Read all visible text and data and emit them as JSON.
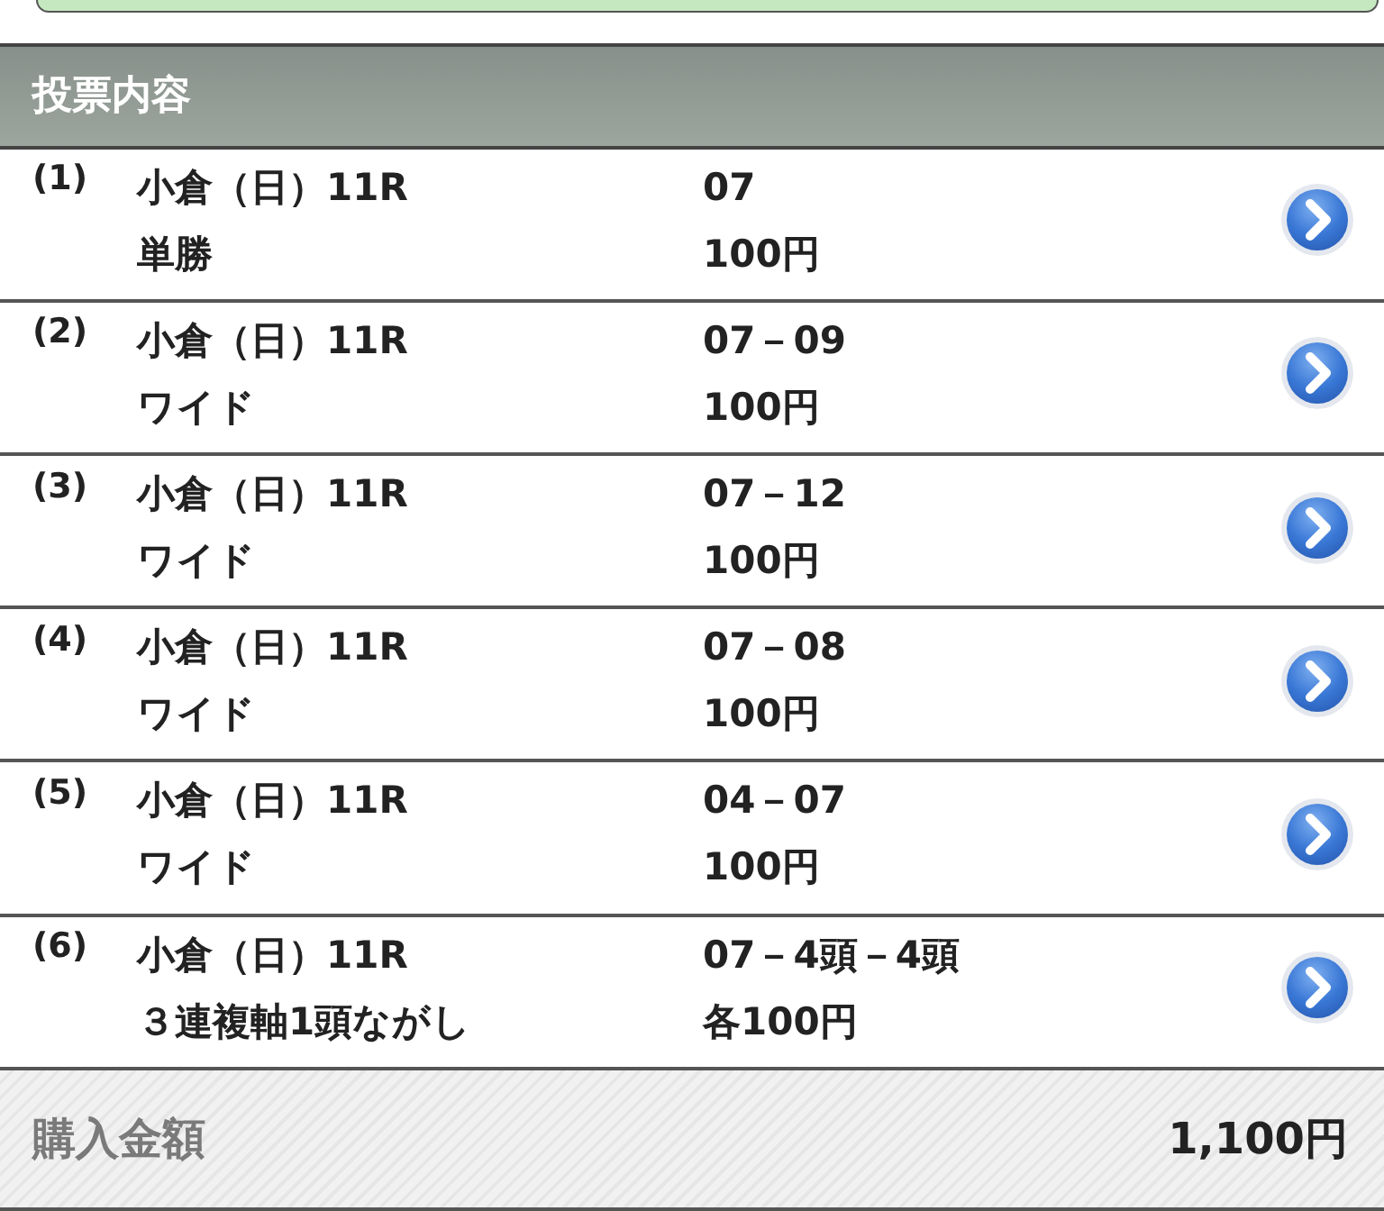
{
  "section_title": "投票内容",
  "bets": [
    {
      "number": "(1)",
      "race": "小倉（日）11R",
      "bet_type": "単勝",
      "selection": "07",
      "amount": "100円"
    },
    {
      "number": "(2)",
      "race": "小倉（日）11R",
      "bet_type": "ワイド",
      "selection": "07－09",
      "amount": "100円"
    },
    {
      "number": "(3)",
      "race": "小倉（日）11R",
      "bet_type": "ワイド",
      "selection": "07－12",
      "amount": "100円"
    },
    {
      "number": "(4)",
      "race": "小倉（日）11R",
      "bet_type": "ワイド",
      "selection": "07－08",
      "amount": "100円"
    },
    {
      "number": "(5)",
      "race": "小倉（日）11R",
      "bet_type": "ワイド",
      "selection": "04－07",
      "amount": "100円"
    },
    {
      "number": "(6)",
      "race": "小倉（日）11R",
      "bet_type": "３連複軸1頭ながし",
      "selection": "07－4頭－4頭",
      "amount": "各100円"
    }
  ],
  "total": {
    "label": "購入金額",
    "amount": "1,100円"
  }
}
